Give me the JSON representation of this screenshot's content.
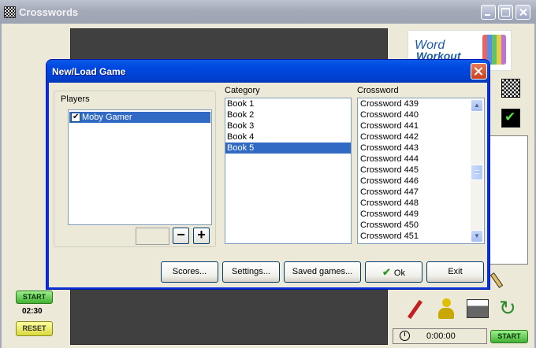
{
  "window": {
    "title": "Crosswords"
  },
  "logo": {
    "line1": "Word",
    "line2": "Workout"
  },
  "left_panel": {
    "start_label": "START",
    "timer": "02:30",
    "reset_label": "RESET"
  },
  "bottom_right": {
    "clock": "0:00:00",
    "start_label": "START"
  },
  "dialog": {
    "title": "New/Load Game",
    "players_label": "Players",
    "players": [
      {
        "name": "Moby Gamer",
        "checked": true,
        "selected": true
      }
    ],
    "minus_label": "−",
    "plus_label": "+",
    "category_label": "Category",
    "categories": [
      "Book 1",
      "Book 2",
      "Book 3",
      "Book 4",
      "Book 5"
    ],
    "selected_category": "Book 5",
    "crossword_label": "Crossword",
    "crosswords": [
      "Crossword 439",
      "Crossword 440",
      "Crossword 441",
      "Crossword 442",
      "Crossword 443",
      "Crossword 444",
      "Crossword 445",
      "Crossword 446",
      "Crossword 447",
      "Crossword 448",
      "Crossword 449",
      "Crossword 450",
      "Crossword 451"
    ],
    "buttons": {
      "scores": "Scores...",
      "settings": "Settings...",
      "saved_games": "Saved games...",
      "ok": "Ok",
      "exit": "Exit"
    }
  },
  "icons": [
    "app-icon",
    "qr-icon",
    "check-icon",
    "pen-icon",
    "pawn-icon",
    "printer-icon",
    "refresh-icon",
    "clock-icon",
    "pencil-icon"
  ],
  "colors": {
    "title_bar": "#0A5BE8",
    "selection": "#316AC5",
    "start_green": "#43B033",
    "reset_yellow": "#D8D840"
  }
}
